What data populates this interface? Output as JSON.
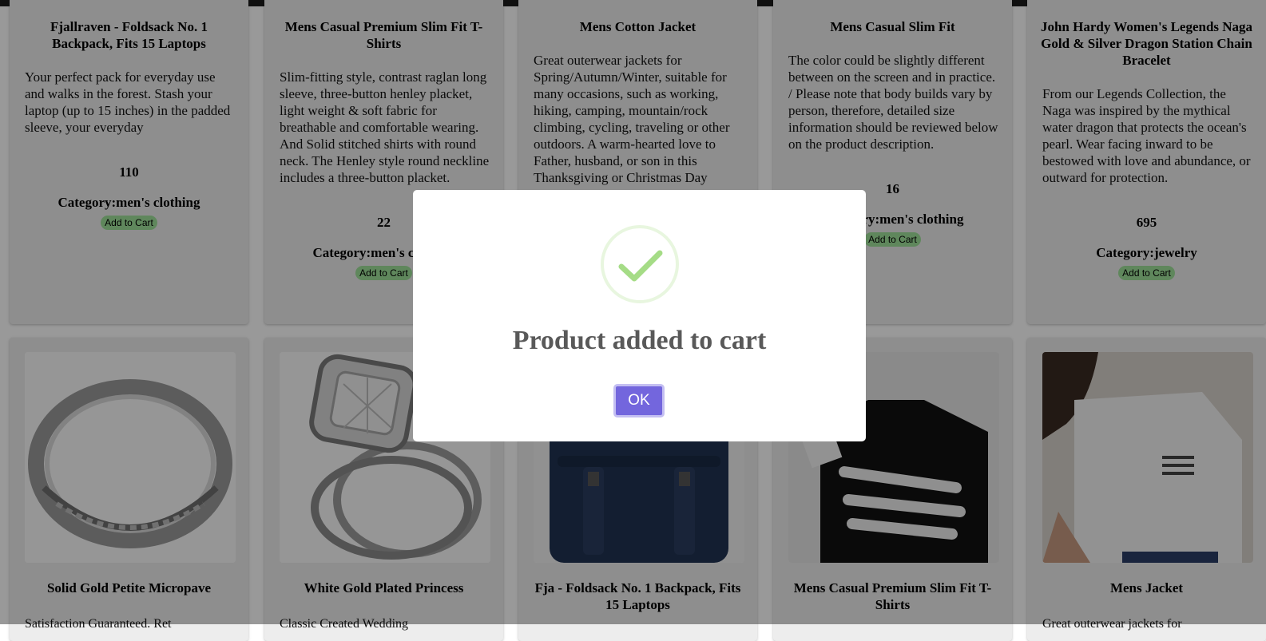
{
  "row1": [
    {
      "title": "Fjallraven - Foldsack No. 1 Backpack, Fits 15 Laptops",
      "description": "Your perfect pack for everyday use and walks in the forest. Stash your laptop (up to 15 inches) in the padded sleeve, your everyday",
      "price": "110",
      "category": "Category:men's clothing",
      "add_label": "Add to Cart"
    },
    {
      "title": "Mens Casual Premium Slim Fit T-Shirts",
      "description": "Slim-fitting style, contrast raglan long sleeve, three-button henley placket, light weight & soft fabric for breathable and comfortable wearing. And Solid stitched shirts with round neck. The Henley style round neckline includes a three-button placket.",
      "price": "22",
      "category": "Category:men's clothing",
      "add_label": "Add to Cart"
    },
    {
      "title": "Mens Cotton Jacket",
      "description": "Great outerwear jackets for Spring/Autumn/Winter, suitable for many occasions, such as working, hiking, camping, mountain/rock climbing, cycling, traveling or other outdoors. A warm-hearted love to Father, husband, or son in this Thanksgiving or Christmas Day",
      "price": "",
      "category": "",
      "add_label": ""
    },
    {
      "title": "Mens Casual Slim Fit",
      "description": "The color could be slightly different between on the screen and in practice. / Please note that body builds vary by person, therefore, detailed size information should be reviewed below on the product description.",
      "price": "16",
      "category": "Category:men's clothing",
      "add_label": "Add to Cart"
    },
    {
      "title": "John Hardy Women's Legends Naga Gold & Silver Dragon Station Chain Bracelet",
      "description": "From our Legends Collection, the Naga was inspired by the mythical water dragon that protects the ocean's pearl. Wear facing inward to be bestowed with love and abundance, or outward for protection.",
      "price": "695",
      "category": "Category:jewelry",
      "add_label": "Add to Cart"
    }
  ],
  "row2": [
    {
      "title": "Solid Gold Petite Micropave",
      "description": "Satisfaction Guaranteed. Ret",
      "image": "gold-ring"
    },
    {
      "title": "White Gold Plated Princess",
      "description": "Classic Created Wedding",
      "image": "diamond-ring"
    },
    {
      "title": "Fja - Foldsack No. 1 Backpack, Fits 15 Laptops",
      "description": "",
      "image": "navy-backpack"
    },
    {
      "title": "Mens Casual Premium Slim Fit T-Shirts",
      "description": "",
      "image": "black-tshirt"
    },
    {
      "title": "Mens Jacket",
      "description": "Great outerwear jackets for",
      "image": "white-tshirt"
    }
  ],
  "modal": {
    "title": "Product added to cart",
    "ok_label": "OK",
    "icon": "success-check-icon",
    "accent": "#7366dd",
    "check_color": "#a5dc86"
  }
}
